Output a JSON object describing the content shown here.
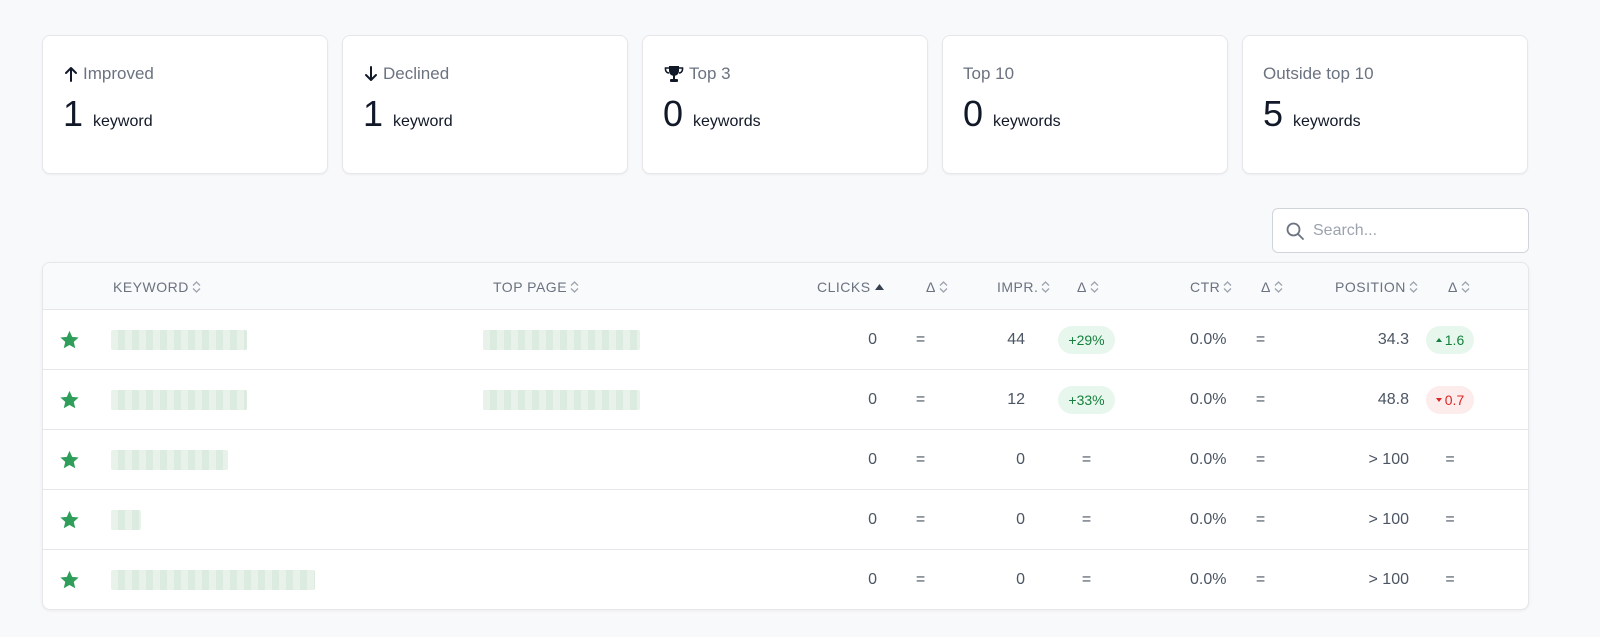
{
  "cards": [
    {
      "icon": "arrow-up-icon",
      "label": "Improved",
      "value": "1",
      "unit": "keyword"
    },
    {
      "icon": "arrow-down-icon",
      "label": "Declined",
      "value": "1",
      "unit": "keyword"
    },
    {
      "icon": "trophy-icon",
      "label": "Top 3",
      "value": "0",
      "unit": "keywords"
    },
    {
      "icon": "",
      "label": "Top 10",
      "value": "0",
      "unit": "keywords"
    },
    {
      "icon": "",
      "label": "Outside top 10",
      "value": "5",
      "unit": "keywords"
    }
  ],
  "search": {
    "placeholder": "Search..."
  },
  "table": {
    "headers": {
      "keyword": "KEYWORD",
      "top_page": "TOP PAGE",
      "clicks": "CLICKS",
      "clicks_delta": "Δ",
      "impressions": "IMPR.",
      "impressions_delta": "Δ",
      "ctr": "CTR",
      "ctr_delta": "Δ",
      "position": "POSITION",
      "position_delta": "Δ"
    },
    "rows": [
      {
        "clicks": "0",
        "clicks_delta": "=",
        "impressions": "44",
        "impressions_delta": "+29%",
        "impressions_delta_type": "up",
        "ctr": "0.0%",
        "ctr_delta": "=",
        "position": "34.3",
        "position_delta": "1.6",
        "position_delta_type": "up"
      },
      {
        "clicks": "0",
        "clicks_delta": "=",
        "impressions": "12",
        "impressions_delta": "+33%",
        "impressions_delta_type": "up",
        "ctr": "0.0%",
        "ctr_delta": "=",
        "position": "48.8",
        "position_delta": "0.7",
        "position_delta_type": "down"
      },
      {
        "clicks": "0",
        "clicks_delta": "=",
        "impressions": "0",
        "impressions_delta": "=",
        "impressions_delta_type": "none",
        "ctr": "0.0%",
        "ctr_delta": "=",
        "position": "> 100",
        "position_delta": "=",
        "position_delta_type": "none"
      },
      {
        "clicks": "0",
        "clicks_delta": "=",
        "impressions": "0",
        "impressions_delta": "=",
        "impressions_delta_type": "none",
        "ctr": "0.0%",
        "ctr_delta": "=",
        "position": "> 100",
        "position_delta": "=",
        "position_delta_type": "none"
      },
      {
        "clicks": "0",
        "clicks_delta": "=",
        "impressions": "0",
        "impressions_delta": "=",
        "impressions_delta_type": "none",
        "ctr": "0.0%",
        "ctr_delta": "=",
        "position": "> 100",
        "position_delta": "=",
        "position_delta_type": "none"
      }
    ]
  },
  "colors": {
    "star": "#2f9e5b",
    "positive": "#15803d",
    "negative": "#dc2626"
  }
}
